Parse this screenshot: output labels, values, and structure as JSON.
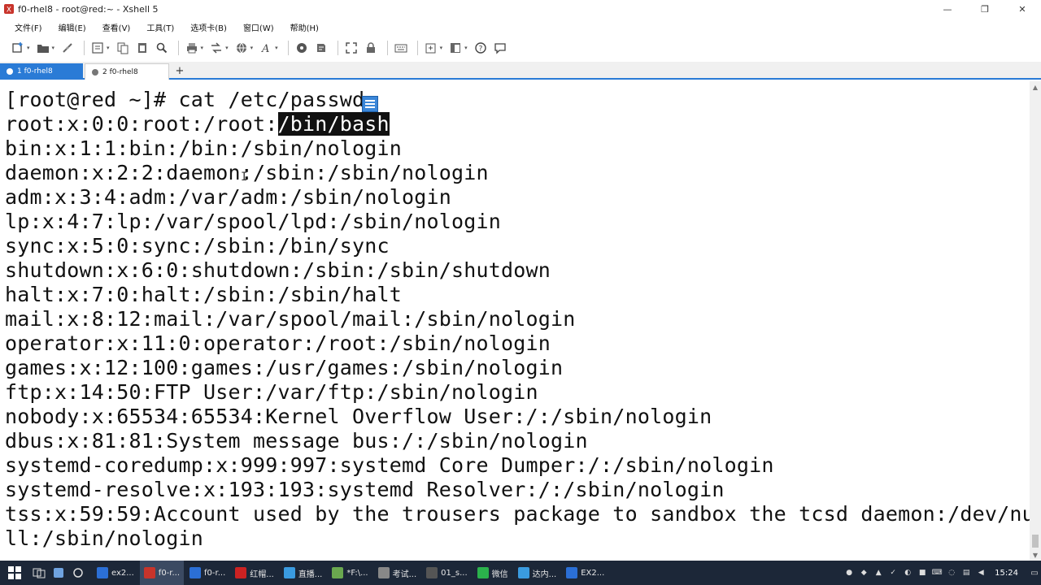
{
  "window": {
    "title": "f0-rhel8 - root@red:~ - Xshell 5",
    "minimize_glyph": "—",
    "maximize_glyph": "❐",
    "close_glyph": "✕"
  },
  "menu": [
    "文件(F)",
    "编辑(E)",
    "查看(V)",
    "工具(T)",
    "选项卡(B)",
    "窗口(W)",
    "帮助(H)"
  ],
  "toolbar": {
    "icons": [
      "new-session-icon",
      "open-folder-icon",
      "disconnect-icon",
      "properties-icon",
      "copy-icon",
      "paste-icon",
      "find-icon",
      "print-icon",
      "transfer-icon",
      "globe-icon",
      "font-icon",
      "xftp-icon",
      "script-icon",
      "fullscreen-icon",
      "lock-icon",
      "keyboard-icon",
      "compose-icon",
      "layout-icon",
      "help-icon",
      "chat-icon"
    ]
  },
  "tabs": [
    {
      "label": "1 f0-rhel8",
      "active": true
    },
    {
      "label": "2 f0-rhel8",
      "active": false
    }
  ],
  "tab_add_glyph": "+",
  "terminal": {
    "prompt_line": "[root@red ~]# cat /etc/passwd",
    "line1_before": "root:x:0:0:root:/root:",
    "line1_selected": "/bin/bash",
    "lines": [
      "bin:x:1:1:bin:/bin:/sbin/nologin",
      "daemon:x:2:2:daemon:/sbin:/sbin/nologin",
      "adm:x:3:4:adm:/var/adm:/sbin/nologin",
      "lp:x:4:7:lp:/var/spool/lpd:/sbin/nologin",
      "sync:x:5:0:sync:/sbin:/bin/sync",
      "shutdown:x:6:0:shutdown:/sbin:/sbin/shutdown",
      "halt:x:7:0:halt:/sbin:/sbin/halt",
      "mail:x:8:12:mail:/var/spool/mail:/sbin/nologin",
      "operator:x:11:0:operator:/root:/sbin/nologin",
      "games:x:12:100:games:/usr/games:/sbin/nologin",
      "ftp:x:14:50:FTP User:/var/ftp:/sbin/nologin",
      "nobody:x:65534:65534:Kernel Overflow User:/:/sbin/nologin",
      "dbus:x:81:81:System message bus:/:/sbin/nologin",
      "systemd-coredump:x:999:997:systemd Core Dumper:/:/sbin/nologin",
      "systemd-resolve:x:193:193:systemd Resolver:/:/sbin/nologin",
      "tss:x:59:59:Account used by the trousers package to sandbox the tcsd daemon:/dev/nu",
      "ll:/sbin/nologin"
    ]
  },
  "taskbar": {
    "apps": [
      {
        "label": "ex2...",
        "color": "#2b6fd6"
      },
      {
        "label": "f0-r...",
        "color": "#c8342b"
      },
      {
        "label": "f0-r...",
        "color": "#2b6fd6"
      },
      {
        "label": "红帽...",
        "color": "#cc2222"
      },
      {
        "label": "直播...",
        "color": "#3a9be0"
      },
      {
        "label": "*F:\\...",
        "color": "#6aa84f"
      },
      {
        "label": "考试...",
        "color": "#888888"
      },
      {
        "label": "01_s...",
        "color": "#555555"
      },
      {
        "label": "微信",
        "color": "#2bb24c"
      },
      {
        "label": "达内...",
        "color": "#3a9be0"
      },
      {
        "label": "EX2...",
        "color": "#2b6fd6"
      }
    ],
    "clock": "15:24"
  }
}
